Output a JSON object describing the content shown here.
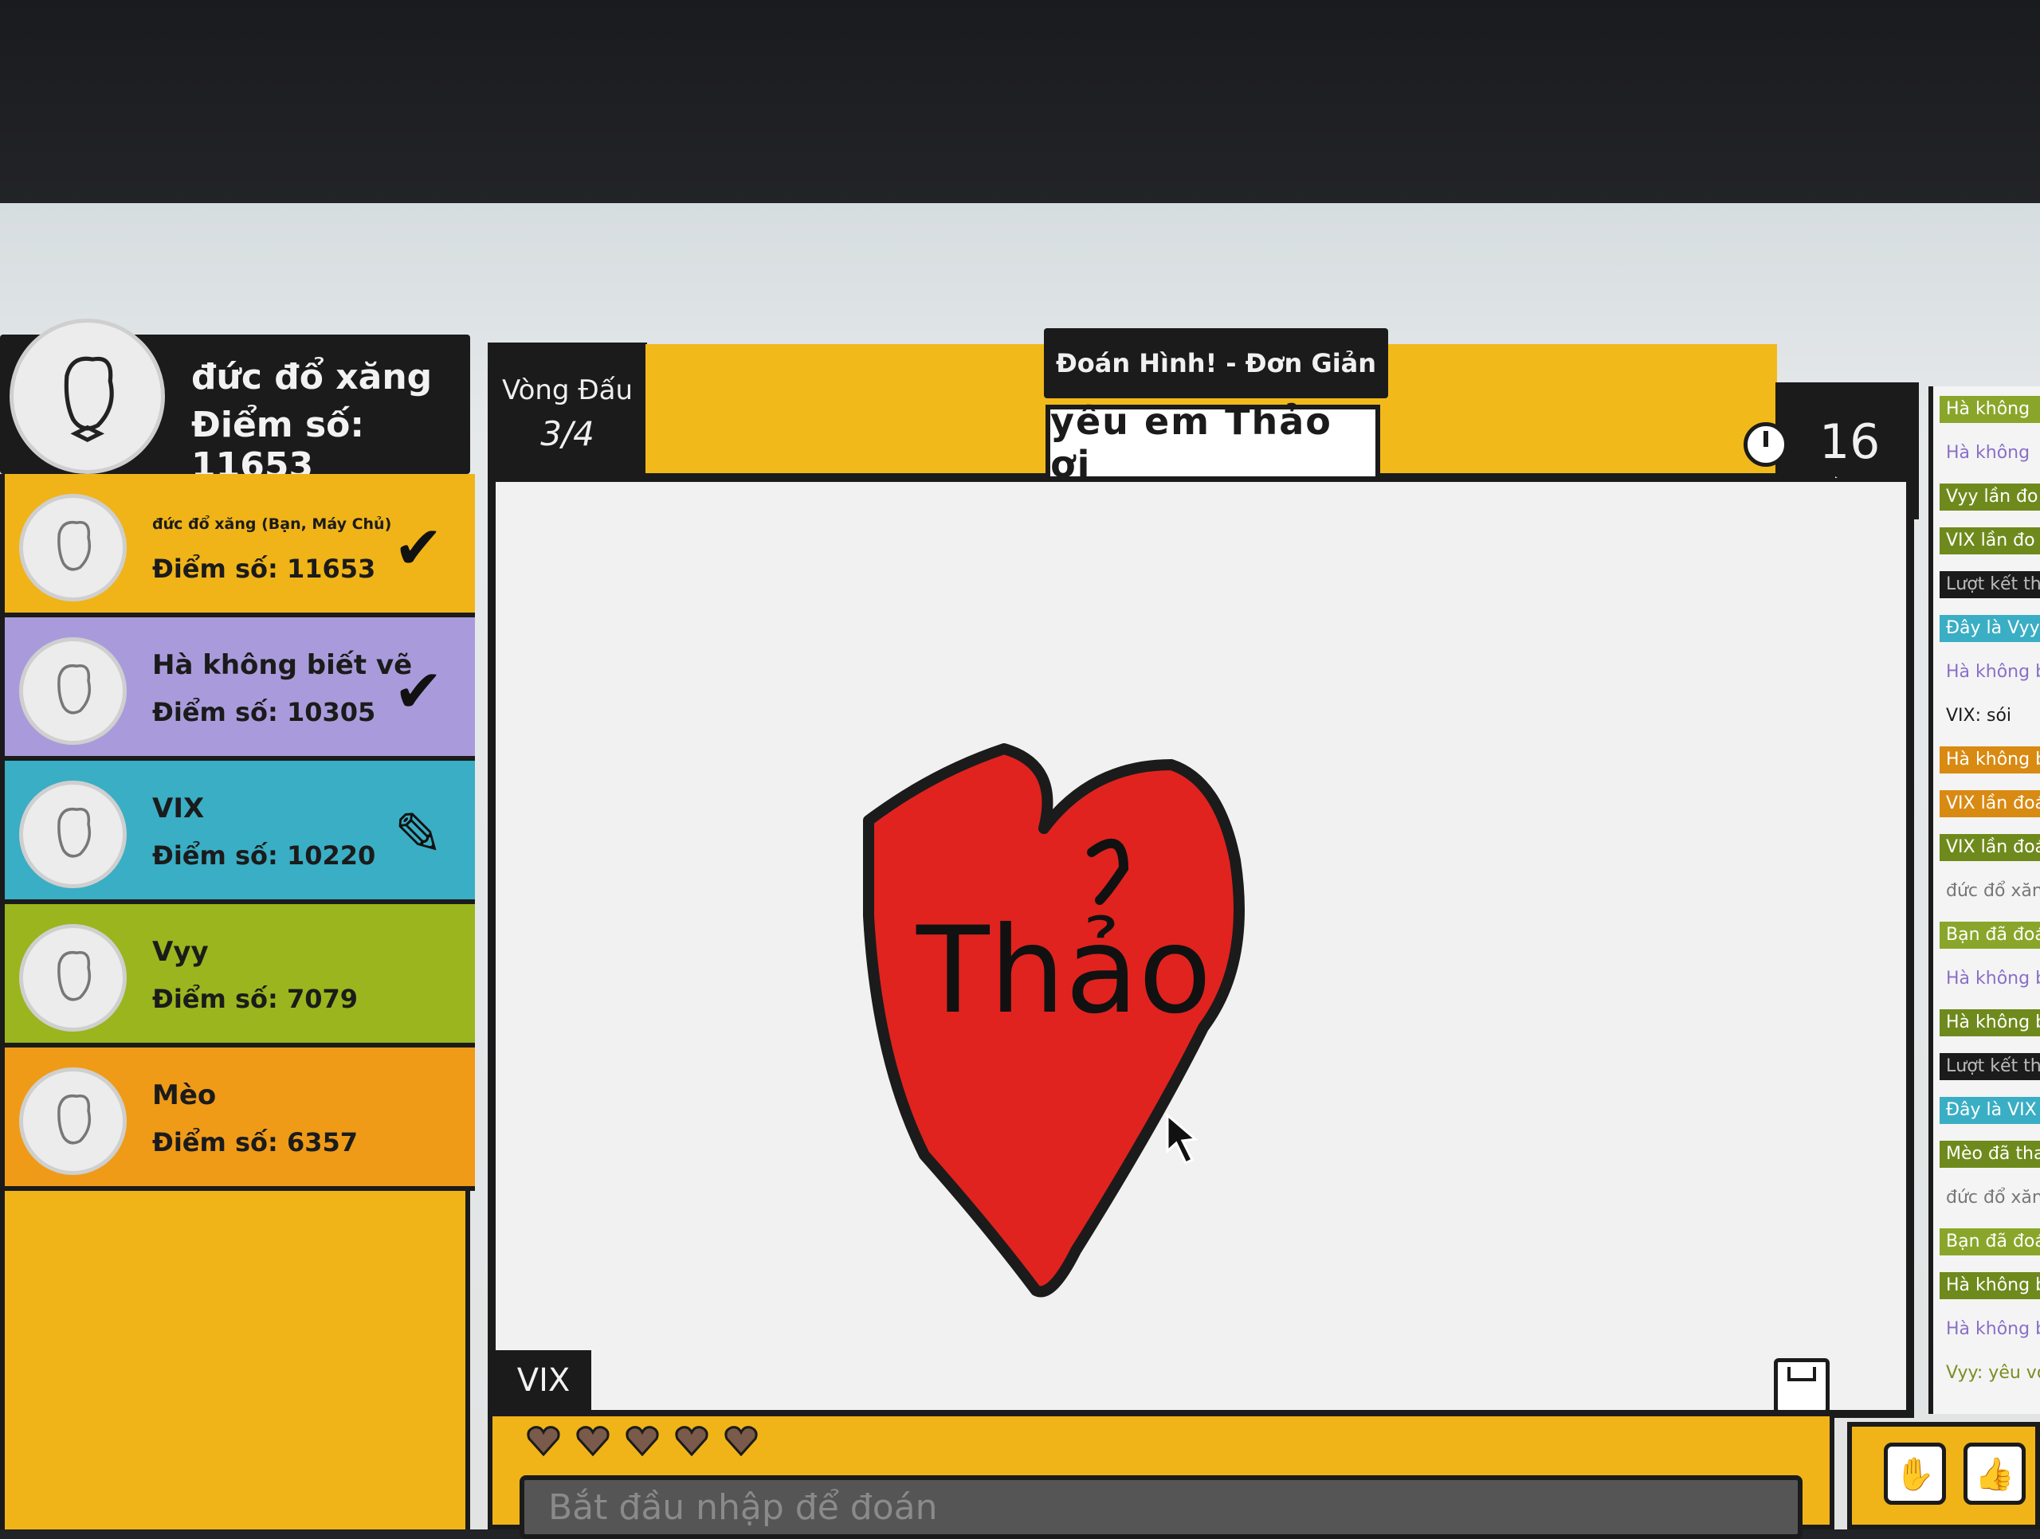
{
  "me": {
    "name": "đức đổ xăng",
    "score_text": "Điểm số: 11653"
  },
  "players": [
    {
      "name": "đức đổ xăng (Bạn, Máy Chủ)",
      "score_text": "Điểm số: 11653",
      "status": "✔",
      "color": "#f0b418"
    },
    {
      "name": "Hà không biết vẽ",
      "score_text": "Điểm số: 10305",
      "status": "✔",
      "color": "#a99bdb"
    },
    {
      "name": "VIX",
      "score_text": "Điểm số: 10220",
      "status": "✎",
      "color": "#3aaec4"
    },
    {
      "name": "Vyy",
      "score_text": "Điểm số: 7079",
      "status": "",
      "color": "#9ab51e"
    },
    {
      "name": "Mèo",
      "score_text": "Điểm số: 6357",
      "status": "",
      "color": "#ef9b18"
    }
  ],
  "round": {
    "label": "Vòng Đấu",
    "value": "3/4"
  },
  "game": {
    "title": "Đoán Hình! - Đơn Giản",
    "hint": "yêu em Thảo ơi"
  },
  "timer": {
    "seconds": "16"
  },
  "canvas": {
    "drawer": "VIX",
    "drawing_text": "Thảo"
  },
  "guess": {
    "placeholder": "Bắt đầu nhập để đoán"
  },
  "lives": 5,
  "chat": [
    {
      "text": "Hà không",
      "bg": "#8aa62a",
      "fg": "#ffffff"
    },
    {
      "text": "Hà không",
      "bg": "transparent",
      "fg": "#8a6fc7"
    },
    {
      "text": "Vyy lần đo",
      "bg": "#6f8a1c",
      "fg": "#ffffff"
    },
    {
      "text": "VIX lần đo",
      "bg": "#6f8a1c",
      "fg": "#ffffff"
    },
    {
      "text": "Lượt kết thúc",
      "bg": "#1b1b1b",
      "fg": "#bbbbbb"
    },
    {
      "text": "Đây là Vyy",
      "bg": "#3aaec4",
      "fg": "#ffffff"
    },
    {
      "text": "Hà không bi",
      "bg": "transparent",
      "fg": "#8a6fc7"
    },
    {
      "text": "VIX: sói",
      "bg": "transparent",
      "fg": "#1b1b1b"
    },
    {
      "text": "Hà không biết",
      "bg": "#d98a12",
      "fg": "#ffffff"
    },
    {
      "text": "VIX lần đoán",
      "bg": "#d98a12",
      "fg": "#ffffff"
    },
    {
      "text": "VIX lần đoán",
      "bg": "#6f8a1c",
      "fg": "#ffffff"
    },
    {
      "text": "đức đổ xăng",
      "bg": "transparent",
      "fg": "#777777"
    },
    {
      "text": "Bạn đã đoán đú",
      "bg": "#8aa62a",
      "fg": "#ffffff"
    },
    {
      "text": "Hà không biết",
      "bg": "transparent",
      "fg": "#8a6fc7"
    },
    {
      "text": "Hà không biết vẽ",
      "bg": "#6f8a1c",
      "fg": "#ffffff"
    },
    {
      "text": "Lượt kết thúc",
      "bg": "#1b1b1b",
      "fg": "#bbbbbb"
    },
    {
      "text": "Đây là VIX sẽ lượt",
      "bg": "#3aaec4",
      "fg": "#ffffff"
    },
    {
      "text": "Mèo đã tham gia",
      "bg": "#6f8a1c",
      "fg": "#ffffff"
    },
    {
      "text": "đức đổ xăng: yêu",
      "bg": "transparent",
      "fg": "#777777"
    },
    {
      "text": "Bạn đã đoán đúng",
      "bg": "#8aa62a",
      "fg": "#ffffff"
    },
    {
      "text": "Hà không biết vẽ lần",
      "bg": "#6f8a1c",
      "fg": "#ffffff"
    },
    {
      "text": "Hà không biết vẽ:",
      "bg": "transparent",
      "fg": "#8a6fc7"
    },
    {
      "text": "Vyy: yêu vợ Thảo",
      "bg": "transparent",
      "fg": "#7d8c22"
    }
  ],
  "colors": {
    "dark": "#1b1b1b",
    "yellow": "#f0b418",
    "heart": "#e0231f"
  },
  "icons": {
    "drawer_tool": "pencil-icon",
    "guessed": "checkmark-icon",
    "timer": "clock-icon",
    "save": "save-icon",
    "hand": "hand-icon",
    "like": "thumbs-up-icon"
  }
}
